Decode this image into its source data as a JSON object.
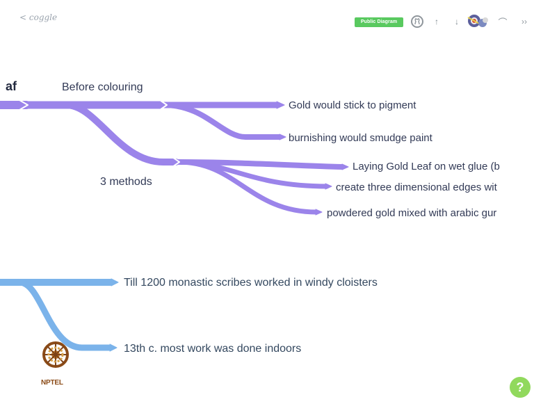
{
  "toolbar": {
    "back_label": "< coggle",
    "public_badge": "Public Diagram",
    "github_icon": "github-icon",
    "up_icon": "arrow-up-icon",
    "down_icon": "arrow-down-icon",
    "avatar_icon": "collaborator-avatar-icon",
    "curve_icon": "curve-icon",
    "more_icon": "more-icon",
    "up_glyph": "↑",
    "down_glyph": "↓",
    "curve_glyph": "⌒",
    "more_glyph": "››"
  },
  "mindmap": {
    "root": "af",
    "branch_1": {
      "label": "Before colouring",
      "children": [
        "Gold would stick to pigment",
        "burnishing would smudge paint"
      ]
    },
    "branch_2": {
      "label": "3 methods",
      "children": [
        "Laying Gold Leaf on wet glue (b",
        "create three dimensional edges wit",
        "powdered gold mixed with arabic gur"
      ]
    },
    "branch_3": {
      "children": [
        "Till 1200 monastic scribes worked in windy cloisters",
        "13th c. most work was done indoors"
      ]
    }
  },
  "logo": {
    "text": "NPTEL"
  },
  "help": {
    "label": "?"
  },
  "colors": {
    "purple_branch": "#9b84ea",
    "blue_branch": "#7bb3ea",
    "text": "#323a56",
    "badge_green": "#59c95f",
    "help_green": "#91d95d"
  }
}
